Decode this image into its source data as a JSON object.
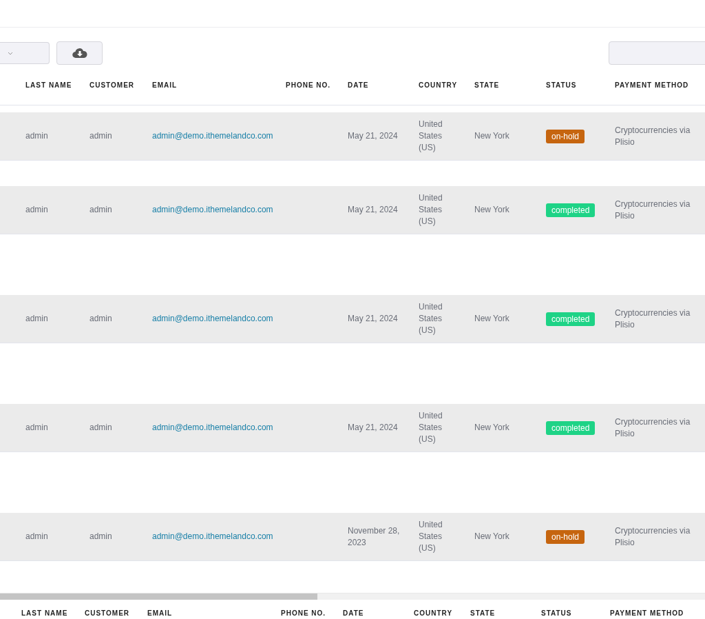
{
  "table": {
    "columns": [
      "LAST NAME",
      "CUSTOMER",
      "EMAIL",
      "PHONE NO.",
      "DATE",
      "COUNTRY",
      "STATE",
      "STATUS",
      "PAYMENT METHOD"
    ],
    "rows": [
      {
        "last_name": "admin",
        "customer": "admin",
        "email": "admin@demo.ithemelandco.com",
        "date": "May 21, 2024",
        "country": "United States (US)",
        "state": "New York",
        "status": {
          "label": "on-hold",
          "color": "#c6650f"
        },
        "payment": "Cryptocurrencies via Plisio"
      },
      {
        "last_name": "admin",
        "customer": "admin",
        "email": "admin@demo.ithemelandco.com",
        "date": "May 21, 2024",
        "country": "United States (US)",
        "state": "New York",
        "status": {
          "label": "completed",
          "color": "#1ed386"
        },
        "payment": "Cryptocurrencies via Plisio"
      },
      {
        "last_name": "admin",
        "customer": "admin",
        "email": "admin@demo.ithemelandco.com",
        "date": "May 21, 2024",
        "country": "United States (US)",
        "state": "New York",
        "status": {
          "label": "completed",
          "color": "#1ed386"
        },
        "payment": "Cryptocurrencies via Plisio"
      },
      {
        "last_name": "admin",
        "customer": "admin",
        "email": "admin@demo.ithemelandco.com",
        "date": "May 21, 2024",
        "country": "United States (US)",
        "state": "New York",
        "status": {
          "label": "completed",
          "color": "#1ed386"
        },
        "payment": "Cryptocurrencies via Plisio"
      },
      {
        "last_name": "admin",
        "customer": "admin",
        "email": "admin@demo.ithemelandco.com",
        "date": "November 28, 2023",
        "country": "United States (US)",
        "state": "New York",
        "status": {
          "label": "on-hold",
          "color": "#c6650f"
        },
        "payment": "Cryptocurrencies via Plisio"
      }
    ],
    "footer_columns": [
      "LAST NAME",
      "CUSTOMER",
      "EMAIL",
      "PHONE NO.",
      "DATE",
      "COUNTRY",
      "STATE",
      "STATUS",
      "PAYMENT METHOD"
    ]
  }
}
